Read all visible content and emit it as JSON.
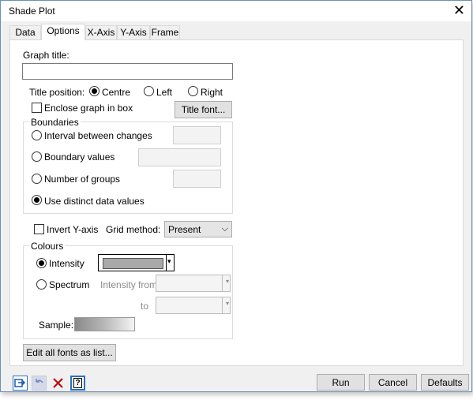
{
  "window": {
    "title": "Shade Plot"
  },
  "tabs": [
    "Data",
    "Options",
    "X-Axis",
    "Y-Axis",
    "Frame"
  ],
  "active_tab": "Options",
  "graph_title": {
    "label": "Graph title:",
    "value": ""
  },
  "title_position": {
    "label": "Title position:",
    "options": [
      "Centre",
      "Left",
      "Right"
    ],
    "selected": "Centre"
  },
  "enclose": {
    "label": "Enclose graph in box",
    "checked": false
  },
  "title_font_button": "Title font...",
  "boundaries": {
    "label": "Boundaries",
    "options": [
      "Interval between changes",
      "Boundary values",
      "Number of groups",
      "Use distinct data values"
    ],
    "selected": "Use distinct data values"
  },
  "invert_y": {
    "label": "Invert Y-axis",
    "checked": false
  },
  "grid_method": {
    "label": "Grid method:",
    "value": "Present"
  },
  "colours": {
    "label": "Colours",
    "intensity_label": "Intensity",
    "spectrum_label": "Spectrum",
    "selected": "Intensity",
    "intensity_color": "#a9a9a9",
    "intensity_from_label": "Intensity from",
    "to_label": "to",
    "sample_label": "Sample:"
  },
  "edit_fonts_button": "Edit all fonts as list...",
  "footer": {
    "run": "Run",
    "cancel": "Cancel",
    "defaults": "Defaults"
  },
  "icons": [
    "pin-icon",
    "undo-icon",
    "clear-icon",
    "help-icon"
  ]
}
